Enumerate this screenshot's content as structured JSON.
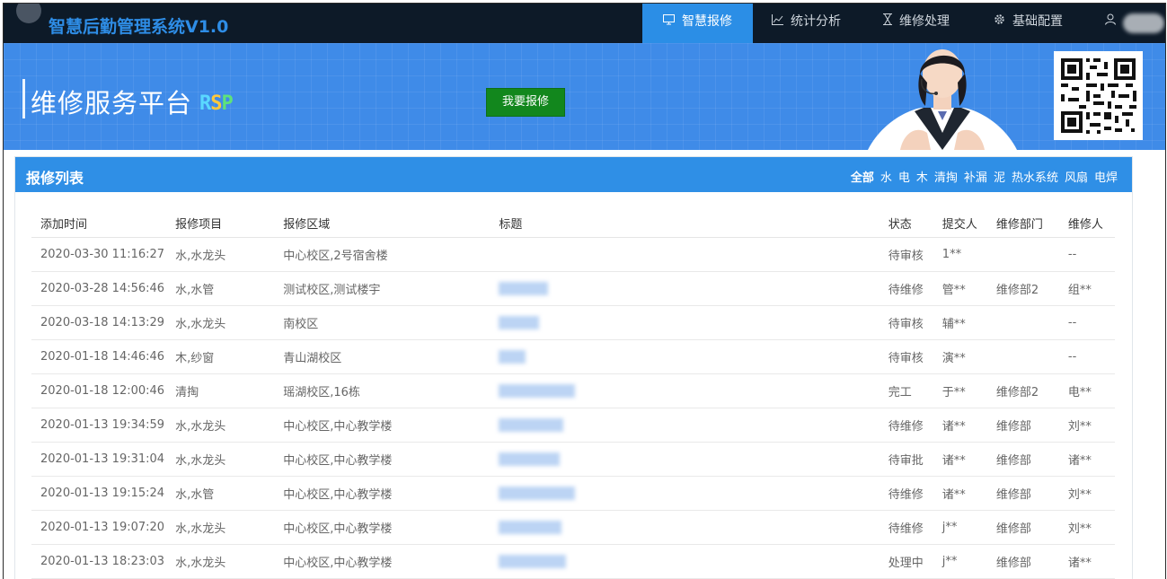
{
  "app": {
    "title": "智慧后勤管理系统V1.0"
  },
  "nav": {
    "items": [
      {
        "label": "智慧报修",
        "icon": "monitor-icon",
        "active": true
      },
      {
        "label": "统计分析",
        "icon": "chart-icon",
        "active": false
      },
      {
        "label": "维修处理",
        "icon": "hourglass-icon",
        "active": false
      },
      {
        "label": "基础配置",
        "icon": "gear-icon",
        "active": false
      }
    ],
    "user_icon": "user-icon"
  },
  "banner": {
    "title": "维修服务平台",
    "logo_text": {
      "r": "R",
      "s": "S",
      "p": "P"
    },
    "report_button": "我要报修"
  },
  "panel": {
    "title": "报修列表",
    "filters": [
      "全部",
      "水",
      "电",
      "木",
      "清掏",
      "补漏",
      "泥",
      "热水系统",
      "风扇",
      "电焊"
    ],
    "active_filter": "全部"
  },
  "table": {
    "headers": [
      "添加时间",
      "报修项目",
      "报修区域",
      "标题",
      "状态",
      "提交人",
      "维修部门",
      "维修人"
    ],
    "rows": [
      {
        "time": "2020-03-30 11:16:27",
        "item": "水,水龙头",
        "area": "中心校区,2号宿舍楼",
        "title_blur": 0,
        "status": "待审核",
        "submitter": "1**",
        "dept": "",
        "repairer": "--"
      },
      {
        "time": "2020-03-28 14:56:46",
        "item": "水,水管",
        "area": "测试校区,测试楼宇",
        "title_blur": 55,
        "status": "待维修",
        "submitter": "管**",
        "dept": "维修部2",
        "repairer": "组**"
      },
      {
        "time": "2020-03-18 14:13:29",
        "item": "水,水龙头",
        "area": "南校区",
        "title_blur": 45,
        "status": "待审核",
        "submitter": "辅**",
        "dept": "",
        "repairer": "--"
      },
      {
        "time": "2020-01-18 14:46:46",
        "item": "木,纱窗",
        "area": "青山湖校区",
        "title_blur": 30,
        "status": "待审核",
        "submitter": "演**",
        "dept": "",
        "repairer": "--"
      },
      {
        "time": "2020-01-18 12:00:46",
        "item": "清掏",
        "area": "瑶湖校区,16栋",
        "title_blur": 85,
        "status": "完工",
        "submitter": "于**",
        "dept": "维修部2",
        "repairer": "电**"
      },
      {
        "time": "2020-01-13 19:34:59",
        "item": "水,水龙头",
        "area": "中心校区,中心教学楼",
        "title_blur": 72,
        "status": "待维修",
        "submitter": "诸**",
        "dept": "维修部",
        "repairer": "刘**"
      },
      {
        "time": "2020-01-13 19:31:04",
        "item": "水,水龙头",
        "area": "中心校区,中心教学楼",
        "title_blur": 68,
        "status": "待审批",
        "submitter": "诸**",
        "dept": "维修部",
        "repairer": "诸**"
      },
      {
        "time": "2020-01-13 19:15:24",
        "item": "水,水管",
        "area": "中心校区,中心教学楼",
        "title_blur": 85,
        "status": "待维修",
        "submitter": "诸**",
        "dept": "维修部",
        "repairer": "刘**"
      },
      {
        "time": "2020-01-13 19:07:20",
        "item": "水,水龙头",
        "area": "中心校区,中心教学楼",
        "title_blur": 70,
        "status": "待维修",
        "submitter": "j**",
        "dept": "维修部",
        "repairer": "刘**"
      },
      {
        "time": "2020-01-13 18:23:03",
        "item": "水,水龙头",
        "area": "中心校区,中心教学楼",
        "title_blur": 75,
        "status": "处理中",
        "submitter": "j**",
        "dept": "维修部",
        "repairer": "诸**"
      }
    ]
  },
  "colors": {
    "navbar": "#0d1a28",
    "accent": "#2b8ee6",
    "banner": "#3f8be8",
    "report_button": "#12871d"
  }
}
